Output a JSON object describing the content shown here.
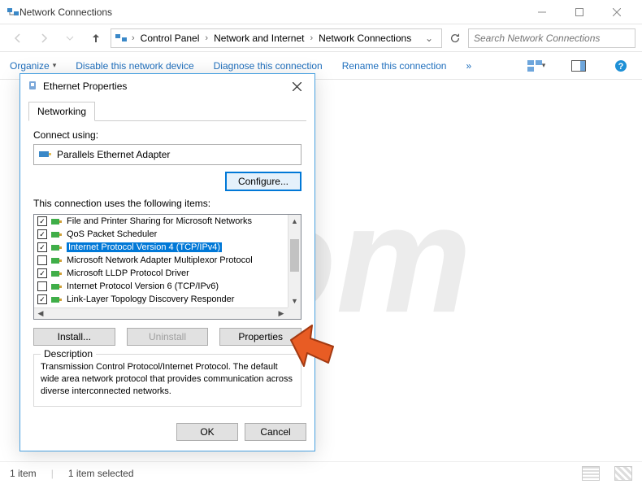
{
  "window": {
    "title": "Network Connections",
    "search_placeholder": "Search Network Connections"
  },
  "breadcrumb": {
    "items": [
      "Control Panel",
      "Network and Internet",
      "Network Connections"
    ]
  },
  "commandbar": {
    "organize": "Organize",
    "disable": "Disable this network device",
    "diagnose": "Diagnose this connection",
    "rename": "Rename this connection",
    "more": "»"
  },
  "statusbar": {
    "count": "1 item",
    "selected": "1 item selected"
  },
  "dialog": {
    "title": "Ethernet Properties",
    "tab": "Networking",
    "connect_using_label": "Connect using:",
    "adapter": "Parallels Ethernet Adapter",
    "configure_btn": "Configure...",
    "items_label": "This connection uses the following items:",
    "items": [
      {
        "checked": true,
        "label": "File and Printer Sharing for Microsoft Networks"
      },
      {
        "checked": true,
        "label": "QoS Packet Scheduler"
      },
      {
        "checked": true,
        "label": "Internet Protocol Version 4 (TCP/IPv4)",
        "selected": true
      },
      {
        "checked": false,
        "label": "Microsoft Network Adapter Multiplexor Protocol"
      },
      {
        "checked": true,
        "label": "Microsoft LLDP Protocol Driver"
      },
      {
        "checked": false,
        "label": "Internet Protocol Version 6 (TCP/IPv6)"
      },
      {
        "checked": true,
        "label": "Link-Layer Topology Discovery Responder"
      }
    ],
    "install_btn": "Install...",
    "uninstall_btn": "Uninstall",
    "properties_btn": "Properties",
    "description_label": "Description",
    "description_text": "Transmission Control Protocol/Internet Protocol. The default wide area network protocol that provides communication across diverse interconnected networks.",
    "ok_btn": "OK",
    "cancel_btn": "Cancel"
  }
}
